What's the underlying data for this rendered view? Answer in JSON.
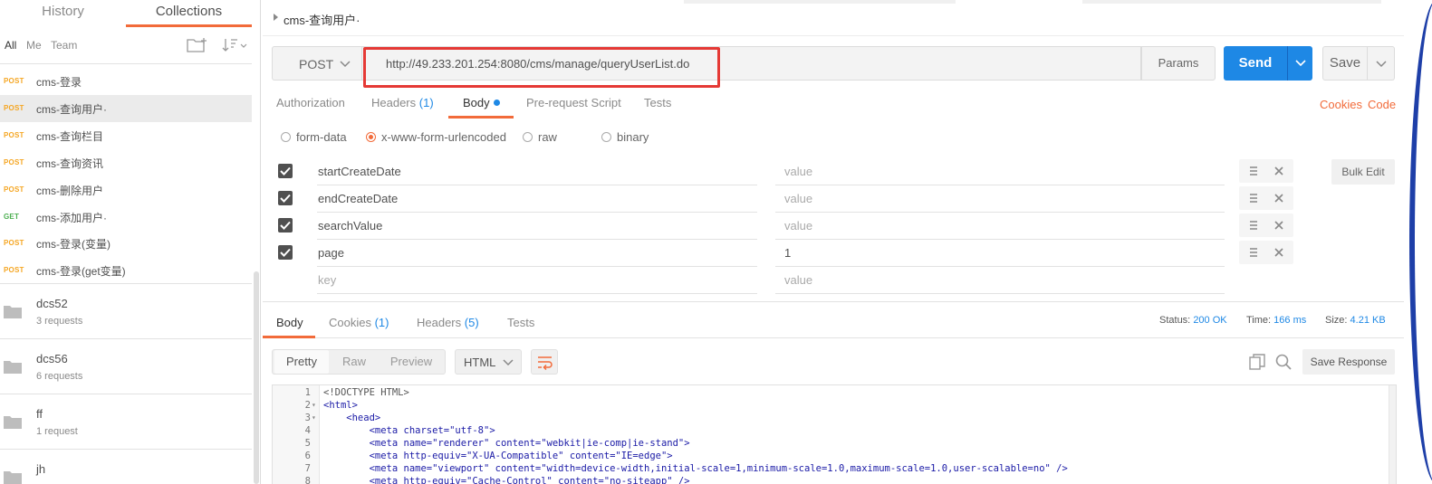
{
  "sidebar": {
    "tabs": [
      "History",
      "Collections"
    ],
    "filters": [
      "All",
      "Me",
      "Team"
    ],
    "requests": [
      {
        "method": "POST",
        "name": "cms-登录"
      },
      {
        "method": "POST",
        "name": "cms-查询用户·"
      },
      {
        "method": "POST",
        "name": "cms-查询栏目"
      },
      {
        "method": "POST",
        "name": "cms-查询资讯"
      },
      {
        "method": "POST",
        "name": "cms-删除用户"
      },
      {
        "method": "GET",
        "name": "cms-添加用户·"
      },
      {
        "method": "POST",
        "name": "cms-登录(变量)"
      },
      {
        "method": "POST",
        "name": "cms-登录(get变量)"
      }
    ],
    "folders": [
      {
        "name": "dcs52",
        "count": "3 requests"
      },
      {
        "name": "dcs56",
        "count": "6 requests"
      },
      {
        "name": "ff",
        "count": "1 request"
      },
      {
        "name": "jh",
        "count": ""
      }
    ]
  },
  "request": {
    "tab_title": "cms-查询用户·",
    "method": "POST",
    "url": "http://49.233.201.254:8080/cms/manage/queryUserList.do",
    "params_label": "Params",
    "send_label": "Send",
    "save_label": "Save",
    "tabs": {
      "authorization": "Authorization",
      "headers": "Headers",
      "headers_count": "(1)",
      "body": "Body",
      "prerequest": "Pre-request Script",
      "tests": "Tests"
    },
    "cookies_link": "Cookies",
    "code_link": "Code",
    "body_types": [
      "form-data",
      "x-www-form-urlencoded",
      "raw",
      "binary"
    ],
    "kv_rows": [
      {
        "key": "startCreateDate",
        "value": ""
      },
      {
        "key": "endCreateDate",
        "value": ""
      },
      {
        "key": "searchValue",
        "value": ""
      },
      {
        "key": "page",
        "value": "1"
      }
    ],
    "key_placeholder": "key",
    "value_placeholder": "value",
    "bulk_edit_label": "Bulk Edit"
  },
  "response": {
    "tabs": {
      "body": "Body",
      "cookies": "Cookies",
      "cookies_count": "(1)",
      "headers": "Headers",
      "headers_count": "(5)",
      "tests": "Tests"
    },
    "status_label": "Status:",
    "status": "200 OK",
    "time_label": "Time:",
    "time": "166 ms",
    "size_label": "Size:",
    "size": "4.21 KB",
    "views": [
      "Pretty",
      "Raw",
      "Preview"
    ],
    "format": "HTML",
    "save_response_label": "Save Response",
    "code_lines": [
      "<!DOCTYPE HTML>",
      "<html>",
      "    <head>",
      "        <meta charset=\"utf-8\">",
      "        <meta name=\"renderer\" content=\"webkit|ie-comp|ie-stand\">",
      "        <meta http-equiv=\"X-UA-Compatible\" content=\"IE=edge\">",
      "        <meta name=\"viewport\" content=\"width=device-width,initial-scale=1,minimum-scale=1.0,maximum-scale=1.0,user-scalable=no\" />",
      "        <meta http-equiv=\"Cache-Control\" content=\"no-siteapp\" />"
    ]
  },
  "colors": {
    "accent": "#f26b3a",
    "primary": "#1e88e5",
    "post": "#f5a623",
    "get": "#4caf50",
    "highlight": "#e53935"
  }
}
